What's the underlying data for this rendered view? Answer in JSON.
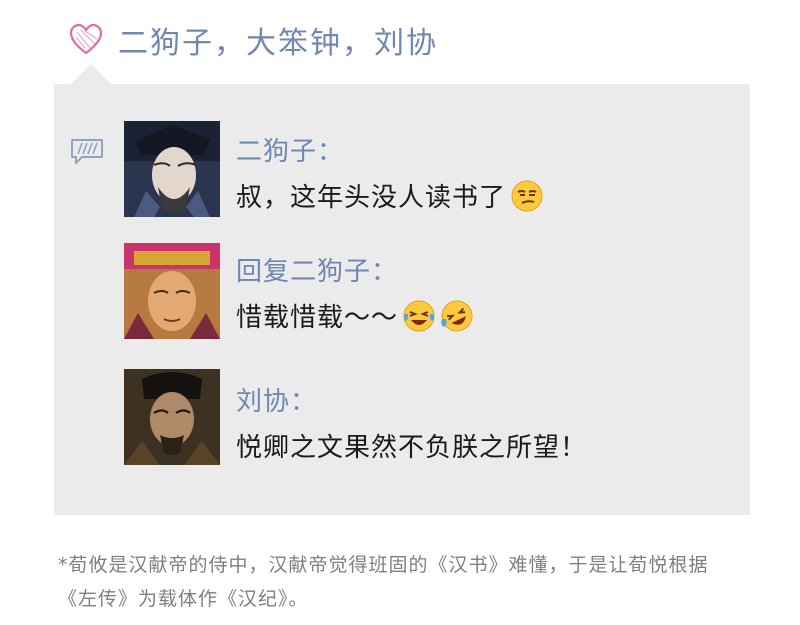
{
  "header": {
    "title": "二狗子，大笨钟，刘协",
    "icon": "heart-icon"
  },
  "comments": [
    {
      "name": "二狗子：",
      "text": "叔，这年头没人读书了",
      "emoji": [
        "smirk-emoji"
      ]
    },
    {
      "name": "回复二狗子：",
      "text": "惜载惜载～～",
      "emoji": [
        "laughing-tears-emoji",
        "rolling-laugh-emoji"
      ]
    },
    {
      "name": "刘协：",
      "text": "悦卿之文果然不负朕之所望！",
      "emoji": []
    }
  ],
  "footnote": "*荀攸是汉献帝的侍中，汉献帝觉得班固的《汉书》难懂，于是让荀悦根据《左传》为载体作《汉纪》。",
  "colors": {
    "accent": "#6e87b3",
    "heart": "#e86aa0",
    "card": "#ebebeb",
    "footnote": "#7f7f7f"
  }
}
